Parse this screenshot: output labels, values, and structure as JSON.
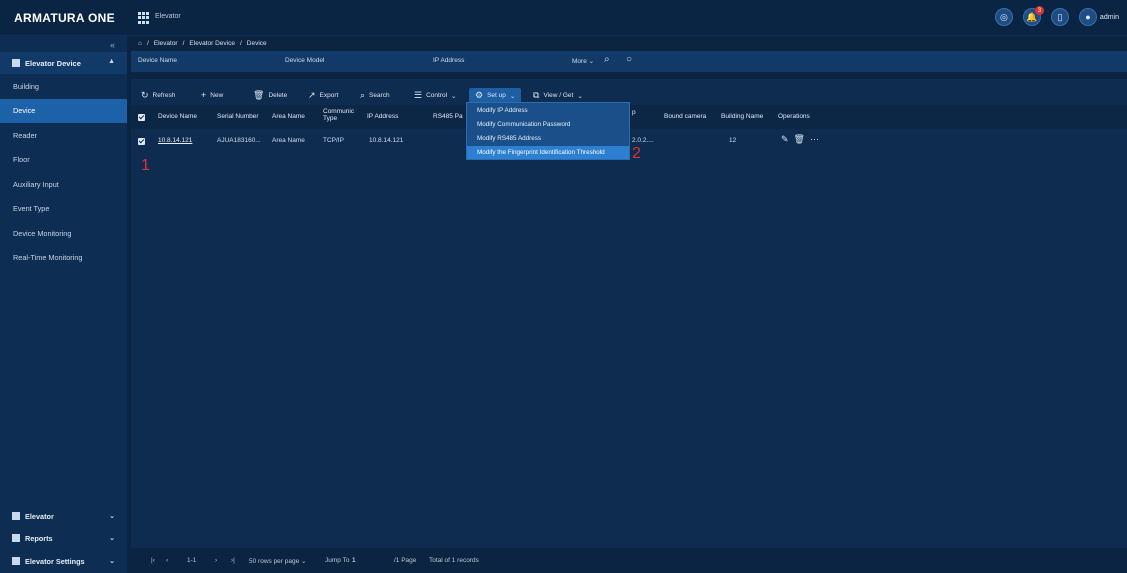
{
  "app": {
    "brand": "ARMATURA ONE",
    "module": "Elevator",
    "user": "admin",
    "notification_count": "3"
  },
  "breadcrumb": [
    "Elevator",
    "Elevator Device",
    "Device"
  ],
  "sidebar": {
    "section": "Elevator Device",
    "items": [
      {
        "label": "Building"
      },
      {
        "label": "Device"
      },
      {
        "label": "Reader"
      },
      {
        "label": "Floor"
      },
      {
        "label": "Auxiliary Input"
      },
      {
        "label": "Event Type"
      },
      {
        "label": "Device Monitoring"
      },
      {
        "label": "Real-Time Monitoring"
      }
    ],
    "bottom": [
      {
        "label": "Elevator"
      },
      {
        "label": "Reports"
      },
      {
        "label": "Elevator Settings"
      }
    ]
  },
  "filters": {
    "device_name": "Device Name",
    "device_model": "Device Model",
    "ip_address": "IP Address",
    "more": "More"
  },
  "toolbar": {
    "refresh": "Refresh",
    "new": "New",
    "delete": "Delete",
    "export": "Export",
    "search": "Search",
    "control": "Control",
    "setup": "Set up",
    "view_get": "View / Get"
  },
  "dropdown": {
    "items": [
      "Modify IP Address",
      "Modify Communication Password",
      "Modify RS485 Address",
      "Modify the Fingerprint Identification Threshold"
    ]
  },
  "table": {
    "headers": {
      "device_name": "Device Name",
      "serial": "Serial Number",
      "area": "Area Name",
      "comm_type_1": "Communic",
      "comm_type_2": "Type",
      "ip": "IP Address",
      "rs485": "RS485 Pa",
      "status": "p",
      "bound_camera": "Bound camera",
      "building": "Building Name",
      "operations": "Operations"
    },
    "rows": [
      {
        "device_name": "10.8.14.121",
        "serial": "AJUA183160...",
        "area": "Area Name",
        "comm_type": "TCP/IP",
        "ip": "10.8.14.121",
        "status": "2.0.2....",
        "building": "12"
      }
    ]
  },
  "footer": {
    "range": "1-1",
    "per_page": "50 rows per page",
    "jump_to": "Jump To",
    "page_value": "1",
    "pages": "/1 Page",
    "total": "Total of 1 records"
  },
  "annotations": {
    "one": "1",
    "two": "2"
  }
}
